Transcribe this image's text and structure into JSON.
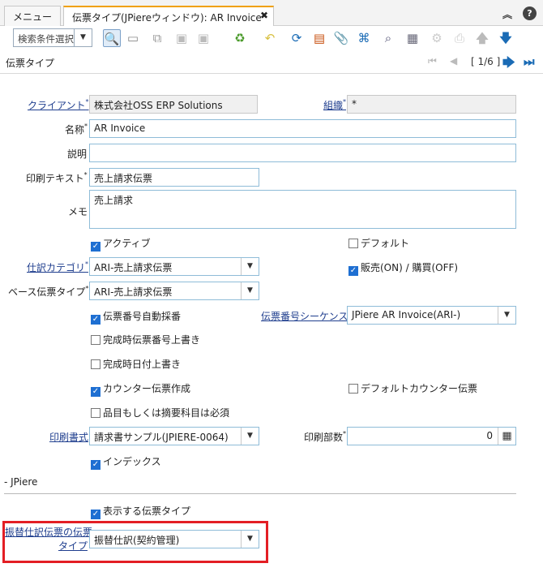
{
  "tabs": {
    "menu": "メニュー",
    "doc": "伝票タイプ(JPiereウィンドウ): AR Invoice"
  },
  "icons": {
    "collapse": "double-chevron-up-icon",
    "help": "help-icon",
    "search": "magnifier-icon",
    "new": "new-record-icon",
    "copy": "copy-icon",
    "save": "save-icon",
    "save_new": "save-new-icon",
    "delete": "delete-icon",
    "undo": "undo-icon",
    "refresh": "refresh-icon",
    "grid": "grid-toggle-icon",
    "attach": "attachment-icon",
    "chat": "chat-icon",
    "zoom": "zoom-icon",
    "report": "report-icon",
    "process": "process-gear-icon",
    "print": "print-icon",
    "up": "arrow-up-icon",
    "down": "arrow-down-icon"
  },
  "toolbar": {
    "search_placeholder": "検索条件選択"
  },
  "header": {
    "title": "伝票タイプ",
    "record_nav": "[ 1/6 ]"
  },
  "form": {
    "client_label": "クライアント",
    "client_value": "株式会社OSS ERP Solutions",
    "org_label": "組織",
    "org_value": "*",
    "name_label": "名称",
    "name_value": "AR Invoice",
    "desc_label": "説明",
    "desc_value": "",
    "print_text_label": "印刷テキスト",
    "print_text_value": "売上請求伝票",
    "memo_label": "メモ",
    "memo_value": "売上請求",
    "active_label": "アクティブ",
    "active": true,
    "default_label": "デフォルト",
    "default": false,
    "category_label": "仕訳カテゴリ",
    "category_value": "ARI-売上請求伝票",
    "sotrx_label": "販売(ON) / 購買(OFF)",
    "sotrx": true,
    "base_type_label": "ベース伝票タイプ",
    "base_type_value": "ARI-売上請求伝票",
    "autonum_label": "伝票番号自動採番",
    "autonum": true,
    "sequence_label": "伝票番号シーケンス",
    "sequence_value": "JPiere AR Invoice(ARI-)",
    "overwrite_seq_label": "完成時伝票番号上書き",
    "overwrite_seq": false,
    "overwrite_date_label": "完成時日付上書き",
    "overwrite_date": false,
    "counter_label": "カウンター伝票作成",
    "counter": true,
    "default_counter_label": "デフォルトカウンター伝票",
    "default_counter": false,
    "charge_mandatory_label": "品目もしくは摘要科目は必須",
    "charge_mandatory": false,
    "print_format_label": "印刷書式",
    "print_format_value": "請求書サンプル(JPIERE-0064)",
    "copies_label": "印刷部数",
    "copies_value": "0",
    "indexed_label": "インデックス",
    "indexed": true,
    "section_label": "- JPiere",
    "display_doc_label": "表示する伝票タイプ",
    "display_doc": true,
    "transfer_label_1": "振替仕訳伝票の伝票",
    "transfer_label_2": "タイプ",
    "transfer_value": "振替仕訳(契約管理)"
  },
  "colors": {
    "highlight": "#e31e24",
    "checkbox": "#1e6fd2",
    "link": "#1f3e8e"
  }
}
